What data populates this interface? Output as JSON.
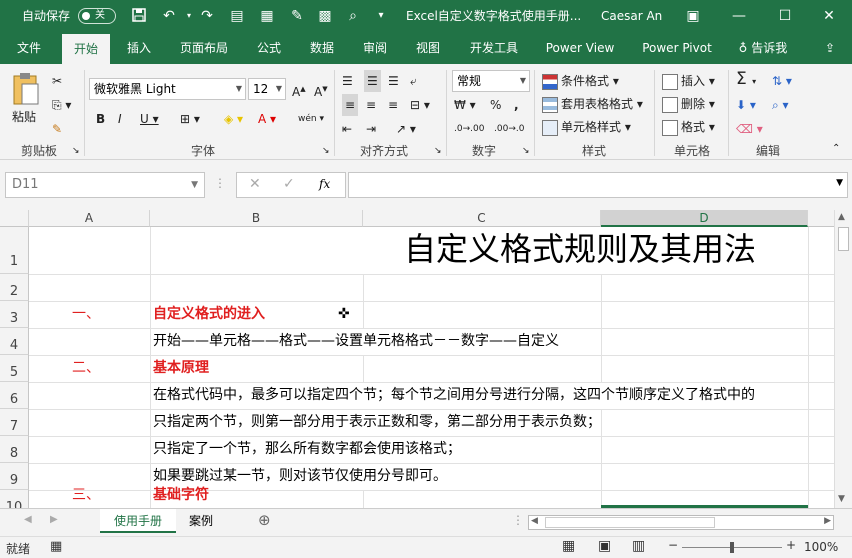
{
  "titlebar": {
    "autosave_label": "自动保存",
    "autosave_state": "关",
    "window_title": "Excel自定义数字格式使用手册...",
    "user_name": "Caesar An"
  },
  "tabs": [
    "文件",
    "开始",
    "插入",
    "页面布局",
    "公式",
    "数据",
    "审阅",
    "视图",
    "开发工具",
    "Power View",
    "Power Pivot",
    "告诉我"
  ],
  "active_tab": "开始",
  "ribbon": {
    "paste_label": "粘贴",
    "font_name": "微软雅黑 Light",
    "font_size": "12",
    "phonetic_label": "wén",
    "number_format": "常规",
    "conditional_format": "条件格式",
    "table_format": "套用表格格式",
    "cell_style": "单元格样式",
    "insert": "插入",
    "delete": "删除",
    "format": "格式",
    "groups": {
      "clipboard": "剪贴板",
      "font": "字体",
      "alignment": "对齐方式",
      "number": "数字",
      "styles": "样式",
      "cells": "单元格",
      "editing": "编辑"
    }
  },
  "formula_bar": {
    "name_box": "D11",
    "fx": "fx",
    "content": ""
  },
  "columns": [
    "A",
    "B",
    "C",
    "D"
  ],
  "selected_column": "D",
  "rows": [
    "1",
    "2",
    "3",
    "4",
    "5",
    "6",
    "7",
    "8",
    "9",
    "10"
  ],
  "cells": {
    "title": "自定义格式规则及其用法",
    "r3a": "一、",
    "r3b": "自定义格式的进入",
    "r4b": "开始——单元格——格式——设置单元格格式－－数字——自定义",
    "r5a": "二、",
    "r5b": "基本原理",
    "r6b": "在格式代码中，最多可以指定四个节；每个节之间用分号进行分隔，这四个节顺序定义了格式中的",
    "r7b": "只指定两个节，则第一部分用于表示正数和零，第二部分用于表示负数；",
    "r8b": "只指定了一个节，那么所有数字都会使用该格式；",
    "r9b": "如果要跳过某一节，则对该节仅使用分号即可。",
    "r10a": "三、",
    "r10b": "基础字符"
  },
  "sheets": [
    "使用手册",
    "案例"
  ],
  "active_sheet": "使用手册",
  "status": {
    "ready": "就绪",
    "zoom": "100%"
  },
  "colors": {
    "brand": "#217346",
    "accent_red": "#e02020"
  }
}
